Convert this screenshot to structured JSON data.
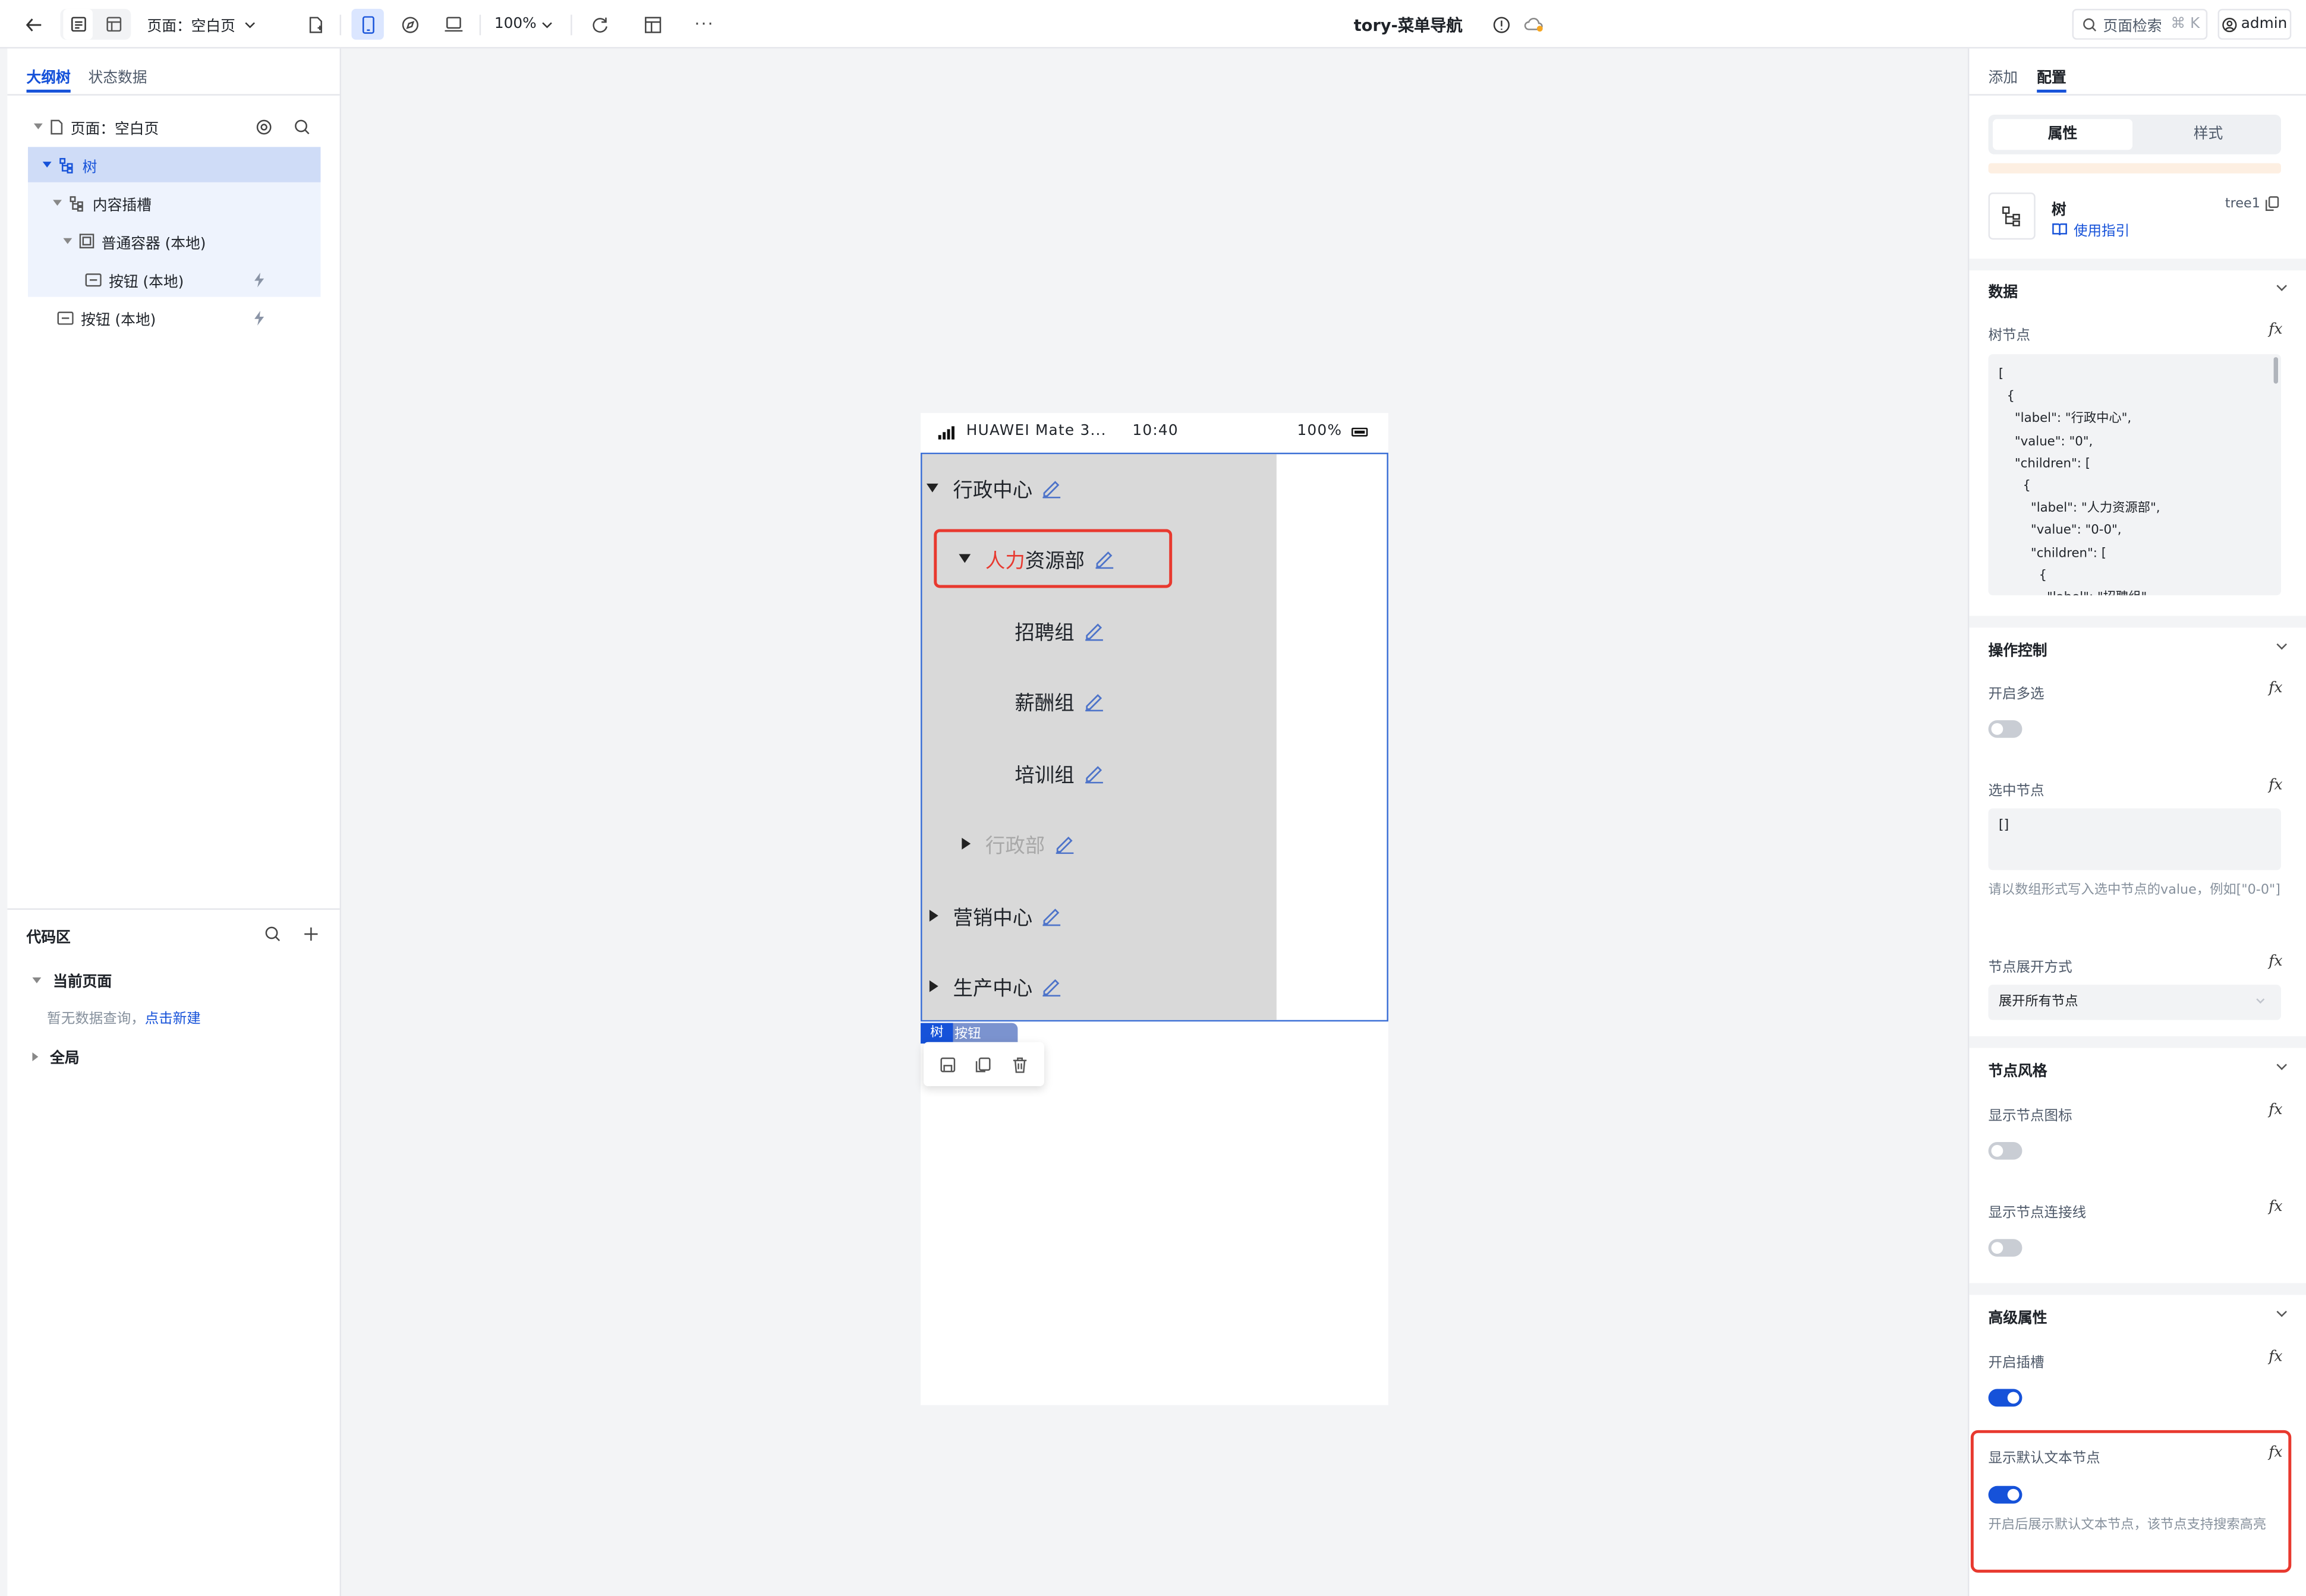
{
  "toolbar": {
    "page_label": "页面：空白页",
    "zoom": "100%",
    "title": "tory-菜单导航",
    "search_label": "页面检索",
    "search_shortcut": "⌘ K",
    "user": "admin",
    "more": "···"
  },
  "left_panel": {
    "tabs": [
      "大纲树",
      "状态数据"
    ],
    "outline": [
      {
        "label": "页面：空白页"
      },
      {
        "label": "树"
      },
      {
        "label": "内容插槽"
      },
      {
        "label": "普通容器 (本地)"
      },
      {
        "label": "按钮 (本地)"
      },
      {
        "label": "按钮 (本地)"
      }
    ],
    "code_area": {
      "title": "代码区",
      "current_page": "当前页面",
      "empty_text": "暂无数据查询，",
      "create_link": "点击新建",
      "global": "全局"
    }
  },
  "phone": {
    "carrier": "HUAWEI Mate 3...",
    "time": "10:40",
    "battery": "100%",
    "tree": [
      {
        "label": "行政中心"
      },
      {
        "label_highlight": "人力",
        "label_rest": "资源部"
      },
      {
        "label": "招聘组"
      },
      {
        "label": "薪酬组"
      },
      {
        "label": "培训组"
      },
      {
        "label": "行政部"
      },
      {
        "label": "营销中心"
      },
      {
        "label": "生产中心"
      }
    ],
    "selection_tag": "树",
    "selection_tag2": "按钮"
  },
  "right_panel": {
    "tabs": [
      "添加",
      "配置"
    ],
    "segment": [
      "属性",
      "样式"
    ],
    "component": {
      "name": "树",
      "guide": "使用指引",
      "id": "tree1"
    },
    "sections": {
      "data": "数据",
      "operation": "操作控制",
      "node_style": "节点风格",
      "advanced": "高级属性"
    },
    "fields": {
      "tree_nodes": "树节点",
      "tree_nodes_code": "[\n  {\n    \"label\": \"行政中心\",\n    \"value\": \"0\",\n    \"children\": [\n      {\n        \"label\": \"人力资源部\",\n        \"value\": \"0-0\",\n        \"children\": [\n          {\n            \"label\": \"招聘组\",",
      "multi_select": "开启多选",
      "selected_nodes": "选中节点",
      "selected_value": "[]",
      "selected_hint": "请以数组形式写入选中节点的value，例如[\"0-0\"]",
      "expand_mode": "节点展开方式",
      "expand_value": "展开所有节点",
      "show_icon": "显示节点图标",
      "show_line": "显示节点连接线",
      "enable_slot": "开启插槽",
      "show_default_text": "显示默认文本节点",
      "show_default_hint": "开启后展示默认文本节点，该节点支持搜索高亮"
    },
    "fx": "fx"
  },
  "colors": {
    "accent": "#1652d9",
    "highlight_red": "#e8392f",
    "tree_bg": "#d9d9d9"
  }
}
